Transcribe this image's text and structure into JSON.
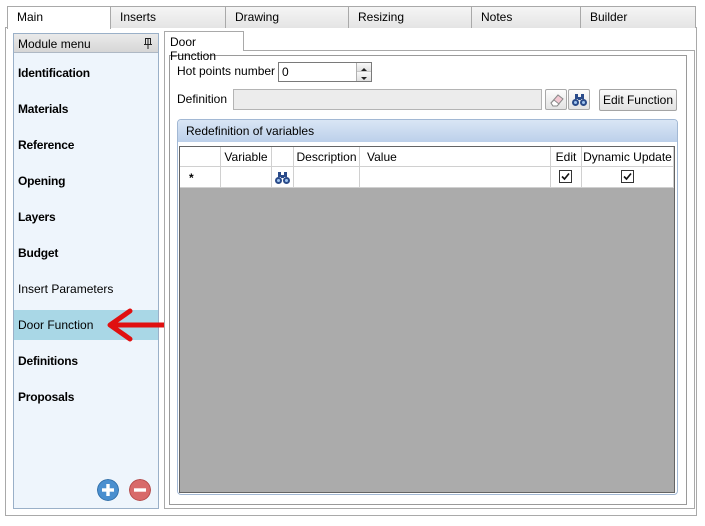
{
  "tabs": [
    {
      "label": "Main",
      "active": true
    },
    {
      "label": "Inserts",
      "active": false
    },
    {
      "label": "Drawing",
      "active": false
    },
    {
      "label": "Resizing",
      "active": false
    },
    {
      "label": "Notes",
      "active": false
    },
    {
      "label": "Builder",
      "active": false
    }
  ],
  "module_menu": {
    "title": "Module menu",
    "items": [
      {
        "label": "Identification",
        "bold": true
      },
      {
        "label": "Materials",
        "bold": true
      },
      {
        "label": "Reference",
        "bold": true
      },
      {
        "label": "Opening",
        "bold": true
      },
      {
        "label": "Layers",
        "bold": true
      },
      {
        "label": "Budget",
        "bold": true
      },
      {
        "label": "Insert Parameters",
        "bold": false
      },
      {
        "label": "Door Function",
        "bold": false,
        "selected": true
      },
      {
        "label": "Definitions",
        "bold": true
      },
      {
        "label": "Proposals",
        "bold": true
      }
    ]
  },
  "door_function": {
    "tab_label": "Door Function",
    "hot_points_label": "Hot points number",
    "hot_points_value": "0",
    "definition_label": "Definition",
    "definition_value": "",
    "edit_function_label": "Edit Function"
  },
  "redefinition": {
    "title": "Redefinition of variables",
    "columns": [
      "",
      "Variable",
      "",
      "Description",
      "Value",
      "Edit",
      "Dynamic Update"
    ],
    "new_row_marker": "*",
    "new_row": {
      "edit_checked": true,
      "dynamic_update_checked": true
    }
  },
  "colors": {
    "selected_item_bg": "#a9d7e6",
    "menu_bg": "#eef5fc",
    "add_button": "#4a8fcf",
    "remove_button": "#d86a6a",
    "arrow": "#e01010",
    "grid_empty_bg": "#ababab"
  },
  "icons": [
    "pin-icon",
    "eraser-icon",
    "binoculars-icon",
    "add-icon",
    "remove-icon",
    "red-arrow-annotation"
  ]
}
